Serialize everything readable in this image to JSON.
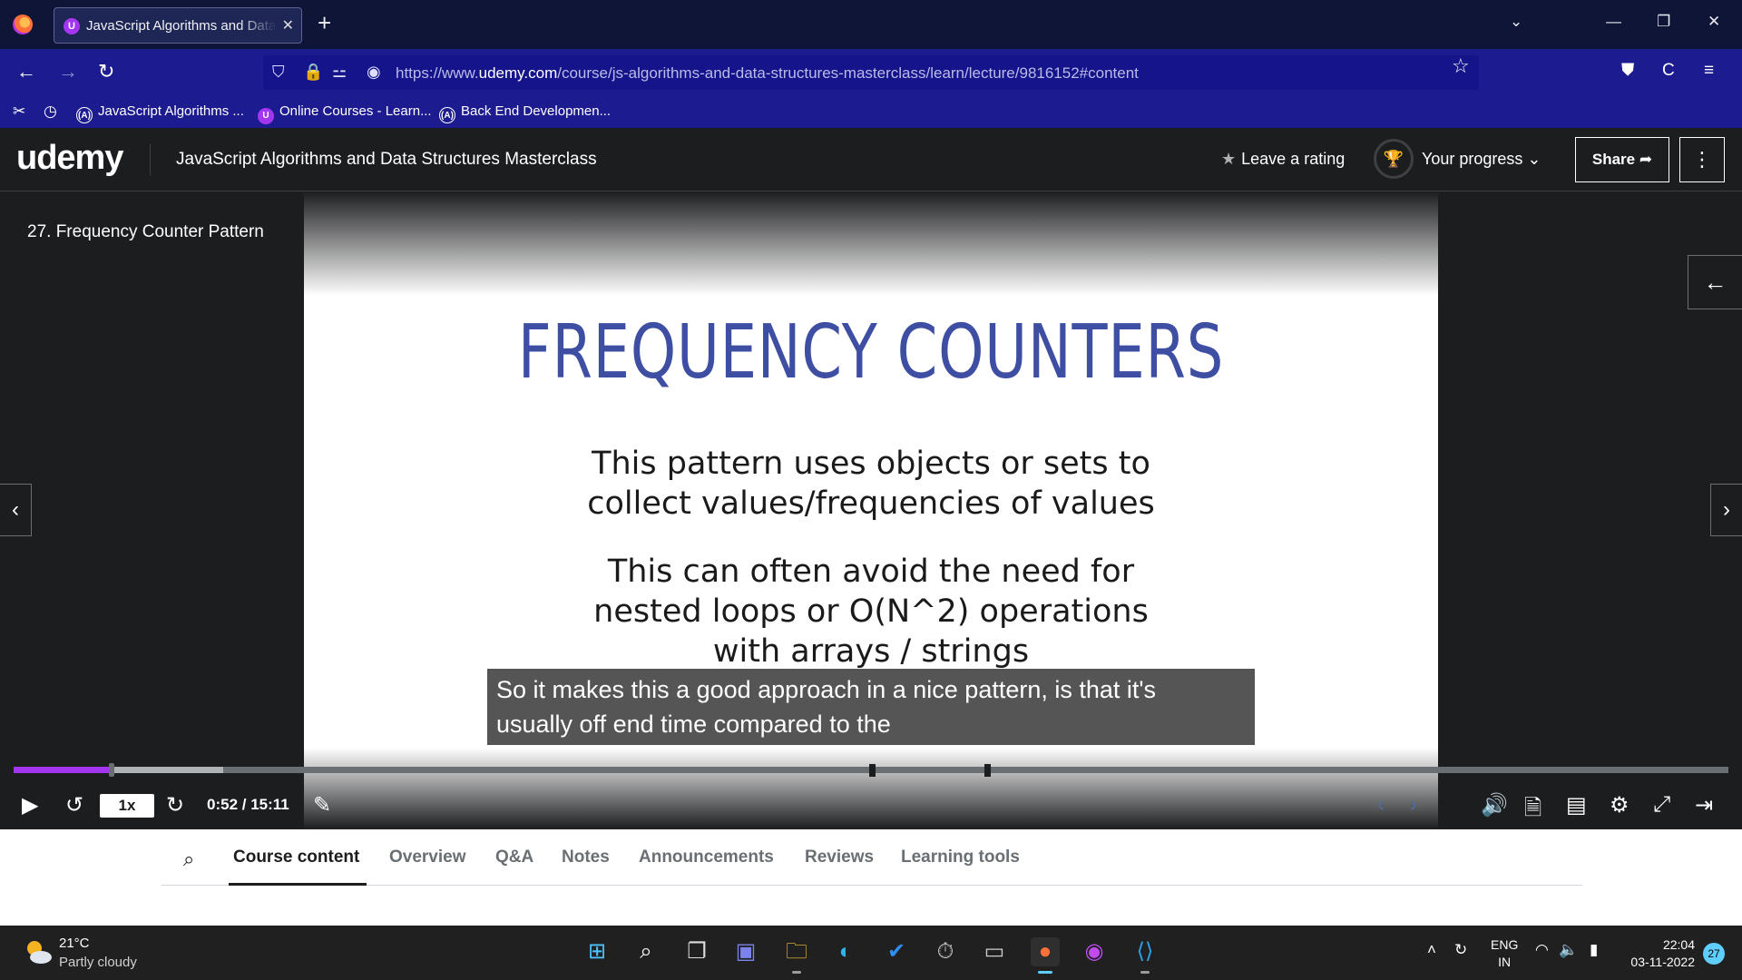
{
  "browser": {
    "tab_title": "JavaScript Algorithms and Data Structures Masterclass",
    "tab_close": "✕",
    "new_tab": "+",
    "url_prefix": "https://www.",
    "url_domain": "udemy.com",
    "url_path": "/course/js-algorithms-and-data-structures-masterclass/learn/lecture/9816152#content",
    "bookmarks": [
      {
        "label": "JavaScript Algorithms ...",
        "favicon": "(A)"
      },
      {
        "label": "Online Courses - Learn...",
        "favicon": "U"
      },
      {
        "label": "Back End Developmen...",
        "favicon": "(A)"
      }
    ]
  },
  "udemy": {
    "logo": "udemy",
    "course_title": "JavaScript Algorithms and Data Structures Masterclass",
    "leave_rating": "Leave a rating",
    "your_progress": "Your progress",
    "share": "Share",
    "more": "⋮"
  },
  "player": {
    "lecture_title": "27. Frequency Counter Pattern",
    "slide": {
      "heading": "FREQUENCY COUNTERS",
      "p1_line1": "This pattern uses objects or sets to",
      "p1_line2": "collect values/frequencies of values",
      "p2_line1": "This can often avoid the need for",
      "p2_line2": "nested loops or O(N^2) operations",
      "p2_line3": "with arrays / strings"
    },
    "caption_line1": "So it makes this a good approach in a nice pattern, is that it's",
    "caption_line2": "usually off end time compared to the",
    "speed": "1x",
    "time": "0:52 / 15:11",
    "played_fraction": 0.057,
    "buffered_fraction": 0.122,
    "accent_color": "#a435f0"
  },
  "tabs": [
    {
      "label": "Course content",
      "active": true
    },
    {
      "label": "Overview",
      "active": false
    },
    {
      "label": "Q&A",
      "active": false
    },
    {
      "label": "Notes",
      "active": false
    },
    {
      "label": "Announcements",
      "active": false
    },
    {
      "label": "Reviews",
      "active": false
    },
    {
      "label": "Learning tools",
      "active": false
    }
  ],
  "taskbar": {
    "temperature": "21°C",
    "weather": "Partly cloudy",
    "lang_line1": "ENG",
    "lang_line2": "IN",
    "time": "22:04",
    "date": "03-11-2022",
    "notifications": "27"
  }
}
